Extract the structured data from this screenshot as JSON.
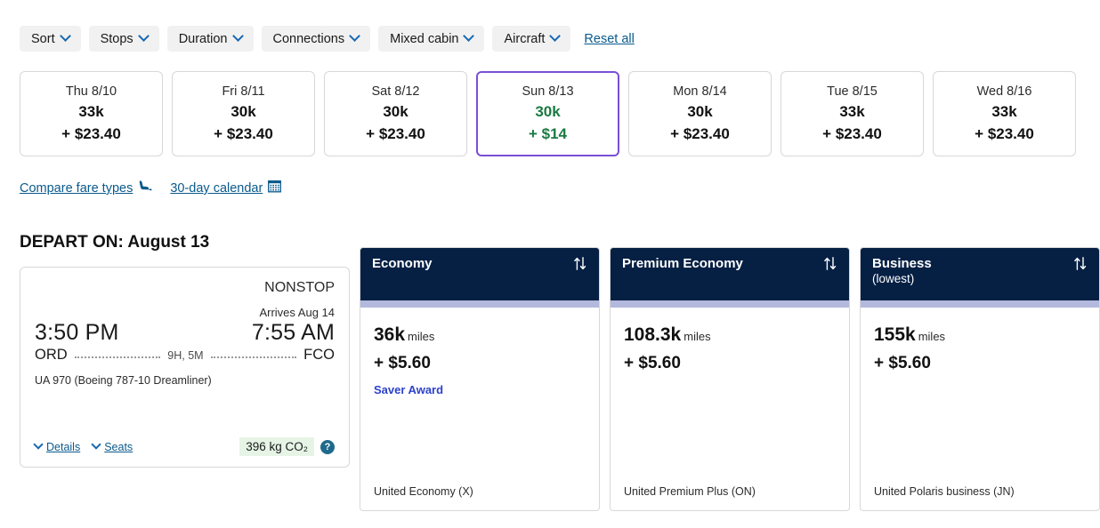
{
  "filters": {
    "chips": [
      {
        "label": "Sort",
        "icon": "chevron-down-icon"
      },
      {
        "label": "Stops",
        "icon": "chevron-down-icon"
      },
      {
        "label": "Duration",
        "icon": "chevron-down-icon"
      },
      {
        "label": "Connections",
        "icon": "chevron-down-icon"
      },
      {
        "label": "Mixed cabin",
        "icon": "chevron-down-icon"
      },
      {
        "label": "Aircraft",
        "icon": "chevron-down-icon"
      }
    ],
    "reset_label": "Reset all"
  },
  "date_strip": [
    {
      "dow": "Thu 8/10",
      "miles": "33k",
      "cash": "+ $23.40",
      "selected": false
    },
    {
      "dow": "Fri 8/11",
      "miles": "30k",
      "cash": "+ $23.40",
      "selected": false
    },
    {
      "dow": "Sat 8/12",
      "miles": "30k",
      "cash": "+ $23.40",
      "selected": false
    },
    {
      "dow": "Sun 8/13",
      "miles": "30k",
      "cash": "+ $14",
      "selected": true
    },
    {
      "dow": "Mon 8/14",
      "miles": "30k",
      "cash": "+ $23.40",
      "selected": false
    },
    {
      "dow": "Tue 8/15",
      "miles": "33k",
      "cash": "+ $23.40",
      "selected": false
    },
    {
      "dow": "Wed 8/16",
      "miles": "33k",
      "cash": "+ $23.40",
      "selected": false
    }
  ],
  "helper_links": {
    "compare_fare_types": "Compare fare types",
    "compare_icon": "seat-icon",
    "calendar_30_day": "30-day calendar",
    "calendar_icon": "calendar-icon"
  },
  "depart": {
    "title": "DEPART ON: August 13",
    "flight": {
      "stops": "NONSTOP",
      "arrives": "Arrives Aug 14",
      "depart_time": "3:50 PM",
      "arrive_time": "7:55 AM",
      "origin": "ORD",
      "destination": "FCO",
      "duration": "9H, 5M",
      "flight_number": "UA 970 (Boeing 787-10 Dreamliner)",
      "details_label": "Details",
      "seats_label": "Seats",
      "co2": "396 kg CO₂",
      "help_glyph": "?"
    }
  },
  "fares": [
    {
      "name": "Economy",
      "sub": "",
      "sort_icon": "sort-icon",
      "miles": "36k",
      "miles_unit": "miles",
      "cash": "+ $5.60",
      "tag": "Saver Award",
      "fare_class": "United Economy (X)"
    },
    {
      "name": "Premium Economy",
      "sub": "",
      "sort_icon": "sort-icon",
      "miles": "108.3k",
      "miles_unit": "miles",
      "cash": "+ $5.60",
      "tag": "",
      "fare_class": "United Premium Plus (ON)"
    },
    {
      "name": "Business",
      "sub": "(lowest)",
      "sort_icon": "sort-icon",
      "miles": "155k",
      "miles_unit": "miles",
      "cash": "+ $5.60",
      "tag": "",
      "fare_class": "United Polaris business (JN)"
    }
  ],
  "colors": {
    "header_navy": "#062044",
    "strip_periwinkle": "#b3b9dd",
    "selected_purple": "#7a4fd6",
    "price_green": "#1a7a42",
    "link_blue": "#0a5a8c",
    "saver_blue": "#2d41cc",
    "co2_green_bg": "#e6f4e6"
  }
}
